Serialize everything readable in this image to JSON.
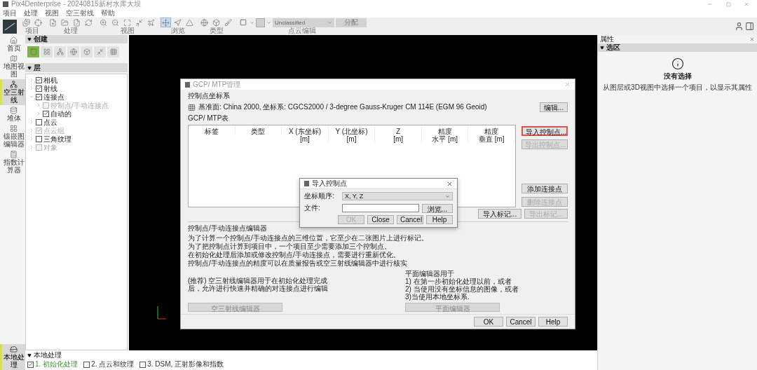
{
  "window": {
    "title": "Pix4Denterprise - 20240815新村水库大坝"
  },
  "menu": [
    "项目",
    "处理",
    "视图",
    "空三射线",
    "帮助"
  ],
  "toolbar": {
    "groups": [
      {
        "label": "项目",
        "tools": [
          {
            "selected": false
          },
          {
            "selected": false
          }
        ]
      },
      {
        "label": "处理",
        "tools": [
          {
            "selected": false
          },
          {
            "selected": false
          },
          {
            "selected": false
          },
          {
            "selected": false
          }
        ]
      },
      {
        "label": "视图",
        "tools": [
          {
            "selected": false
          },
          {
            "selected": false
          },
          {
            "selected": false
          },
          {
            "selected": false
          },
          {
            "selected": false
          }
        ]
      },
      {
        "label": "浏览",
        "tools": [
          {
            "selected": true
          },
          {
            "selected": false
          },
          {
            "selected": false
          }
        ]
      },
      {
        "label": "类型",
        "tools": [
          {
            "selected": false
          },
          {
            "selected": false
          },
          {
            "selected": false
          }
        ]
      }
    ],
    "point_cloud_edit": {
      "label": "点云编辑",
      "class_value": "Unclassified",
      "assign_button": "分配"
    }
  },
  "nav": [
    {
      "label": "首页",
      "selected": false
    },
    {
      "label": "地图视图",
      "selected": false
    },
    {
      "label": "空三射线",
      "selected": true
    },
    {
      "label": "堆体",
      "selected": false
    },
    {
      "label": "镶嵌图编辑器",
      "selected": false
    },
    {
      "label": "指数计算器",
      "selected": false
    }
  ],
  "nav_bottom": {
    "label": "本地处理",
    "selected": true
  },
  "create_panel": {
    "title": "创建"
  },
  "layers_panel": {
    "title": "层",
    "tree": [
      {
        "label": "相机",
        "checked": true,
        "disabled": false,
        "expanded": false
      },
      {
        "label": "射线",
        "checked": true,
        "disabled": false,
        "expanded": false
      },
      {
        "label": "连接点",
        "checked": true,
        "disabled": false,
        "expanded": true,
        "children": [
          {
            "label": "控制点/手动连接点",
            "checked": false,
            "disabled": true,
            "expanded": false
          },
          {
            "label": "自动的",
            "checked": true,
            "disabled": false,
            "expanded": false
          }
        ]
      },
      {
        "label": "点云",
        "checked": false,
        "disabled": false,
        "expanded": false
      },
      {
        "label": "点云组",
        "checked": true,
        "disabled": true,
        "expanded": false
      },
      {
        "label": "三角纹理",
        "checked": false,
        "disabled": false,
        "expanded": false
      },
      {
        "label": "对象",
        "checked": false,
        "disabled": true,
        "expanded": false
      }
    ]
  },
  "processing": {
    "title": "本地处理",
    "steps": [
      {
        "label": "1. 初始化处理",
        "checked": true
      },
      {
        "label": "2. 点云和纹理",
        "checked": false
      },
      {
        "label": "3. DSM, 正射影像和指数",
        "checked": false
      }
    ]
  },
  "properties": {
    "title": "属性",
    "section": "选区",
    "empty_title": "没有选择",
    "empty_text": "从图层或3D视图中选择一个项目，以显示其属性"
  },
  "gcp_dialog": {
    "title": "GCP/ MTP管理",
    "coord_label": "控制点坐标系",
    "coord_text": "基准面: China 2000, 坐标系: CGCS2000 / 3-degree Gauss-Kruger CM 114E (EGM 96 Geoid)",
    "edit_button": "编辑...",
    "table_label": "GCP/ MTP表",
    "columns": [
      [
        "标签"
      ],
      [
        "类型"
      ],
      [
        "X (东坐标)",
        "[m]"
      ],
      [
        "Y (北坐标)",
        "[m]"
      ],
      [
        "Z",
        "[m]"
      ],
      [
        "精度",
        "水平 [m]"
      ],
      [
        "精度",
        "垂直 [m]"
      ]
    ],
    "side_buttons": [
      {
        "label": "导入控制点...",
        "disabled": false,
        "highlighted": true
      },
      {
        "label": "导出控制点...",
        "disabled": true,
        "highlighted": false
      },
      {
        "label": "添加连接点",
        "disabled": false,
        "highlighted": false
      },
      {
        "label": "删除连接点",
        "disabled": true,
        "highlighted": false
      }
    ],
    "mark_buttons": [
      {
        "label": "导入标记...",
        "disabled": false
      },
      {
        "label": "导出标记...",
        "disabled": true
      }
    ],
    "editor_title": "控制点/手动连接点编辑器",
    "editor_lines": [
      "为了计算一个控制点/手动连接点的三维位置，它至少在二张图片上进行标记。",
      "为了把控制点计算到项目中，一个项目至少需要添加三个控制点。",
      "在初始化处理后添加或修改控制点/手动连接点，需要进行重新优化。",
      "控制点/手动连接点的精度可以在质量报告或空三射线编辑器中进行核实"
    ],
    "ray_editor_text": "(推荐) 空三射线编辑器用于在初始化处理完成后，允许进行快速并精确的对连接点进行编辑",
    "ray_editor_button": {
      "label": "空三射线编辑器",
      "disabled": true
    },
    "plane_editor_lines": [
      "平面编辑器用于",
      "1) 在第一步初始化处理以前，或者",
      "2) 当使用没有坐标信息的图像，或者",
      "3)当使用本地坐标系."
    ],
    "plane_editor_button": {
      "label": "平面编辑器",
      "disabled": true
    },
    "footer_buttons": [
      {
        "label": "OK",
        "disabled": false
      },
      {
        "label": "Cancel",
        "disabled": false
      },
      {
        "label": "Help",
        "disabled": false
      }
    ]
  },
  "import_dialog": {
    "title": "导入控制点",
    "order_label": "坐标顺序:",
    "order_value": "X, Y, Z",
    "file_label": "文件:",
    "browse_button": "浏览...",
    "buttons": [
      {
        "label": "OK",
        "disabled": true
      },
      {
        "label": "Close",
        "disabled": false
      },
      {
        "label": "Cancel",
        "disabled": false
      },
      {
        "label": "Help",
        "disabled": false
      }
    ]
  }
}
